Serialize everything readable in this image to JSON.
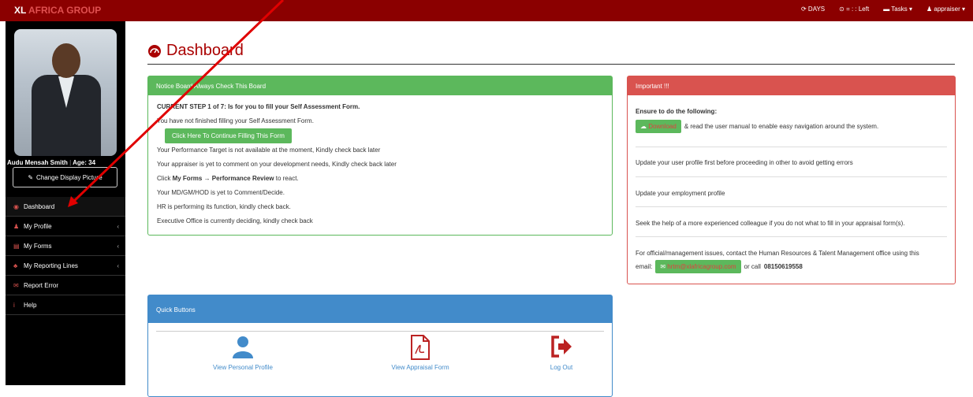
{
  "brand": {
    "part1": "XL",
    "part2": "AFRICA GROUP"
  },
  "topnav": {
    "days": "DAYS",
    "timer": "= : : Left",
    "tasks": "Tasks",
    "user": "appraiser"
  },
  "profile": {
    "name": "Audu Mensah Smith",
    "age": "Age: 34",
    "change_pic": "Change Display Picture"
  },
  "menu": [
    {
      "label": "Dashboard"
    },
    {
      "label": "My Profile"
    },
    {
      "label": "My Forms"
    },
    {
      "label": "My Reporting Lines"
    },
    {
      "label": "Report Error"
    },
    {
      "label": "Help"
    }
  ],
  "page": {
    "title": "Dashboard"
  },
  "notice": {
    "header": "Notice Board Always Check This Board",
    "step": "CURRENT STEP 1 of 7: Is for you to fill your Self Assessment Form.",
    "not_finished": "You have not finished filling your Self Assessment Form.",
    "continue_btn": "Click Here To Continue Filling This Form",
    "target": "Your Performance Target is not available at the moment, Kindly check back later",
    "appraiser": "Your appraiser is yet to comment on your development needs, Kindly check back later",
    "click_prefix": "Click",
    "click_bold": "My Forms → Performance Review",
    "click_suffix": "to react.",
    "md": "Your MD/GM/HOD is yet to Comment/Decide.",
    "hr": "HR is performing its function, kindly check back.",
    "exec": "Executive Office is currently deciding, kindly check back"
  },
  "important": {
    "header": "Important !!!",
    "ensure": "Ensure to do the following:",
    "download_btn": "Download",
    "manual": "& read the user manual to enable easy navigation around the system.",
    "update_profile": "Update your user profile first before proceeding in other to avoid getting errors",
    "update_employment": "Update your employment profile",
    "seek_help": "Seek the help of a more experienced colleague if you do not what to fill in your appraisal form(s).",
    "official1": "For official/management issues, contact the Human Resources & Talent Management office using this",
    "email_label": "email:",
    "email_btn": "hrtm@xlafricagroup.com",
    "or_call": "or call",
    "phone": "08150619558"
  },
  "quick": {
    "header": "Quick Buttons",
    "personal": "View Personal Profile",
    "appraisal": "View Appraisal Form",
    "logout": "Log Out"
  },
  "colors": {
    "topbar": "#8b0000",
    "green": "#5cb85c",
    "red": "#d9534f",
    "blue": "#428bca",
    "annotation": "#e00000"
  }
}
